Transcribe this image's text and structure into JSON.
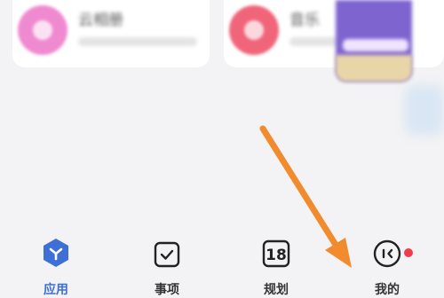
{
  "cards": [
    {
      "title": "云相册",
      "icon_color": "#f08ad0"
    },
    {
      "title": "音乐",
      "icon_color": "#f0657a"
    }
  ],
  "colors": {
    "accent": "#3d6fd6",
    "arrow": "#f28a2e",
    "badge": "#ef3e4a"
  },
  "tabbar": {
    "active": "apps",
    "items": [
      {
        "id": "apps",
        "label": "应用",
        "icon": "apps-hexagon-icon"
      },
      {
        "id": "tasks",
        "label": "事项",
        "icon": "checkbox-icon"
      },
      {
        "id": "plan",
        "label": "规划",
        "icon": "calendar-18-icon",
        "icon_text": "18"
      },
      {
        "id": "me",
        "label": "我的",
        "icon": "face-icon",
        "badge": true
      }
    ]
  }
}
